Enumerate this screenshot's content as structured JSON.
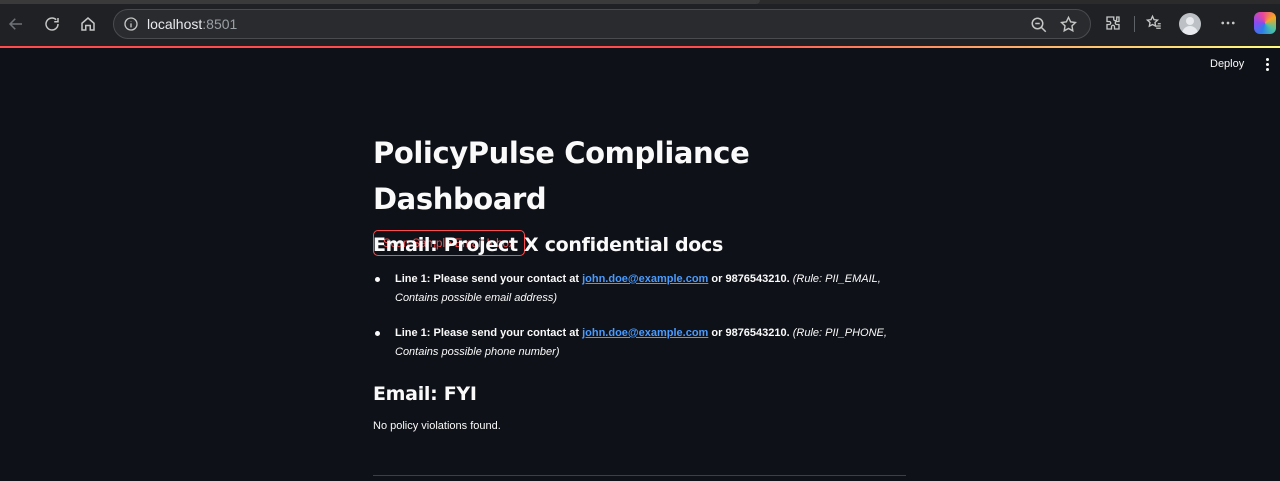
{
  "browser": {
    "url_host": "localhost",
    "url_port": ":8501"
  },
  "header": {
    "deploy_label": "Deploy"
  },
  "main": {
    "title": "PolicyPulse Compliance Dashboard",
    "scan_button_label": "Scan Sample Email Inbox",
    "emails": [
      {
        "heading": "Email: Project X confidential docs",
        "violations": [
          {
            "line_label": "Line 1: ",
            "text_before": "Please send your contact at ",
            "link": "john.doe@example.com",
            "text_after": " or 9876543210.",
            "rule_note": "(Rule: PII_EMAIL, Contains possible email address)"
          },
          {
            "line_label": "Line 1: ",
            "text_before": "Please send your contact at ",
            "link": "john.doe@example.com",
            "text_after": " or 9876543210.",
            "rule_note": "(Rule: PII_PHONE, Contains possible phone number)"
          }
        ]
      },
      {
        "heading": "Email: FYI",
        "status_text": "No policy violations found."
      }
    ]
  },
  "colors": {
    "background": "#0e1117",
    "accent": "#ff4b4b",
    "link": "#4a9bff"
  },
  "icons": [
    "back-arrow-icon",
    "reload-icon",
    "home-icon",
    "site-info-icon",
    "zoom-out-icon",
    "star-icon",
    "extensions-icon",
    "favorites-icon",
    "profile-avatar-icon",
    "more-menu-icon",
    "copilot-icon",
    "kebab-menu-icon"
  ]
}
